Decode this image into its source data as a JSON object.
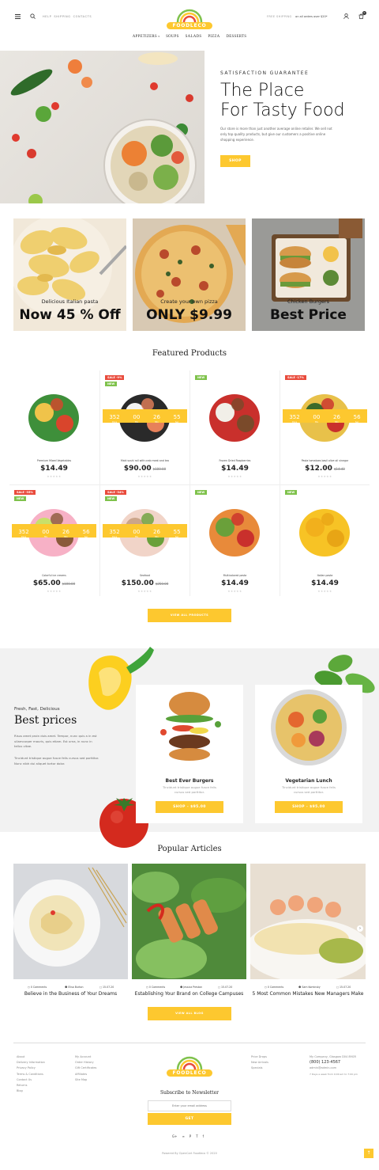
{
  "header": {
    "top_links": [
      "HELP",
      "SHIPPING",
      "CONTACTS"
    ],
    "brand": "FOODLECO",
    "shipping_label": "FREE SHIPPING",
    "shipping_detail": "on all orders over $20*",
    "cart_count": "0",
    "nav": [
      "APPETIZERS",
      "SOUPS",
      "SALADS",
      "PIZZA",
      "DESSERTS"
    ]
  },
  "hero": {
    "eyebrow": "SATISFACTION GUARANTEE",
    "title_line1": "The Place",
    "title_line2": "For Tasty Food",
    "text": "Our store is more than just another average online retailer. We sell not only top quality products, but give our customers a positive online shopping experience.",
    "button": "SHOP"
  },
  "promos": [
    {
      "sub": "Delicious Italian pasta",
      "big": "Now 45 % Off"
    },
    {
      "sub": "Create your own pizza",
      "big": "ONLY $9.99"
    },
    {
      "sub": "Chicken Burgers",
      "big": "Best Price"
    }
  ],
  "featured": {
    "title": "Featured Products",
    "view_all": "VIEW ALL PRODUCTS",
    "timer_units": [
      "Days",
      "Hrs",
      "Min",
      "Sec"
    ],
    "products": [
      {
        "name": "Premium Mixed Vegetables",
        "price": "$14.49",
        "old": "",
        "badges": [],
        "timer": null
      },
      {
        "name": "Maki sushi roll with crab meat and tea",
        "price": "$90.00",
        "old": "$180.00",
        "badges": [
          {
            "t": "SALE -9%",
            "k": "sale"
          },
          {
            "t": "NEW",
            "k": "new"
          }
        ],
        "timer": [
          "352",
          "00",
          "26",
          "55"
        ]
      },
      {
        "name": "Frozen Dried Raspberries",
        "price": "$14.49",
        "old": "",
        "badges": [
          {
            "t": "NEW",
            "k": "new"
          }
        ],
        "timer": null
      },
      {
        "name": "Pasta tomatoes basil olive oil vinegar",
        "price": "$12.00",
        "old": "$14.40",
        "badges": [
          {
            "t": "SALE -17%",
            "k": "sale"
          }
        ],
        "timer": [
          "352",
          "00",
          "26",
          "56"
        ]
      },
      {
        "name": "Colorful ice creams",
        "price": "$65.00",
        "old": "$100.00",
        "badges": [
          {
            "t": "SALE -35%",
            "k": "sale"
          },
          {
            "t": "NEW",
            "k": "new"
          }
        ],
        "timer": [
          "352",
          "00",
          "26",
          "56"
        ]
      },
      {
        "name": "Seafood",
        "price": "$150.00",
        "old": "$250.00",
        "badges": [
          {
            "t": "SALE -34%",
            "k": "sale"
          },
          {
            "t": "NEW",
            "k": "new"
          }
        ],
        "timer": [
          "352",
          "00",
          "26",
          "55"
        ]
      },
      {
        "name": "Multicolored pasta",
        "price": "$14.49",
        "old": "",
        "badges": [
          {
            "t": "NEW",
            "k": "new"
          }
        ],
        "timer": null
      },
      {
        "name": "Italian pasta",
        "price": "$14.49",
        "old": "",
        "badges": [
          {
            "t": "NEW",
            "k": "new"
          }
        ],
        "timer": null
      }
    ]
  },
  "prices": {
    "eyebrow": "Fresh, Fast, Delicious",
    "title": "Best prices",
    "p1": "Risus amet proin duis amet. Tempor, nunc quis a in est ullamcorper mauris, quis etiam. Est urna, in nunc in tellus vitae.",
    "p2": "Tincidunt tristique augue fusce felis cursus sed porttitor. Nunc nibh dui aliquet tortor dolor.",
    "cards": [
      {
        "title": "Best Ever Burgers",
        "desc": "Tincidunt tristique augue fusce felis cursus sed porttitor.",
        "button": "SHOP - $95.00"
      },
      {
        "title": "Vegetarian Lunch",
        "desc": "Tincidunt tristique augue fusce felis cursus sed porttitor.",
        "button": "SHOP - $95.00"
      }
    ]
  },
  "articles": {
    "title": "Popular Articles",
    "view_all": "VIEW ALL BLOG",
    "items": [
      {
        "comments": "0 Comments",
        "author": "Elisa Burton",
        "date": "15.07.20",
        "title": "Believe in the Business of Your Dreams"
      },
      {
        "comments": "0 Comments",
        "author": "Jessica Preston",
        "date": "15.07.20",
        "title": "Establishing Your Brand on College Campuses"
      },
      {
        "comments": "0 Comments",
        "author": "Sam Kominsky",
        "date": "15.07.20",
        "title": "5 Most Common Mistakes New Managers Make"
      }
    ]
  },
  "footer": {
    "col1": [
      "About",
      "Delivery Information",
      "Privacy Policy",
      "Terms & Conditions",
      "Contact Us",
      "Returns",
      "Blog"
    ],
    "col2": [
      "My Account",
      "Order History",
      "Gift Certificates",
      "Affiliates",
      "Site Map"
    ],
    "col3": [
      "Price Drops",
      "New Arrivals",
      "Specials"
    ],
    "contact": [
      "My Company, Glasgow D04 89GR",
      "(800) 123-4567",
      "admin@admin.com",
      "7 Days a week from 9:00 am to 7:00 pm"
    ],
    "brand": "FOODLECO",
    "newsletter_title": "Subscribe to Newsletter",
    "newsletter_placeholder": "Enter your email address",
    "get": "GET",
    "social": [
      "G+",
      "∞",
      "P",
      "T",
      "f"
    ],
    "powered": "Powered By OpenCart Foodleco © 2020"
  },
  "colors": {
    "accent": "#fdc82f",
    "sale": "#e94b3c",
    "new": "#7fc24c",
    "band": "#f2f2f2"
  }
}
